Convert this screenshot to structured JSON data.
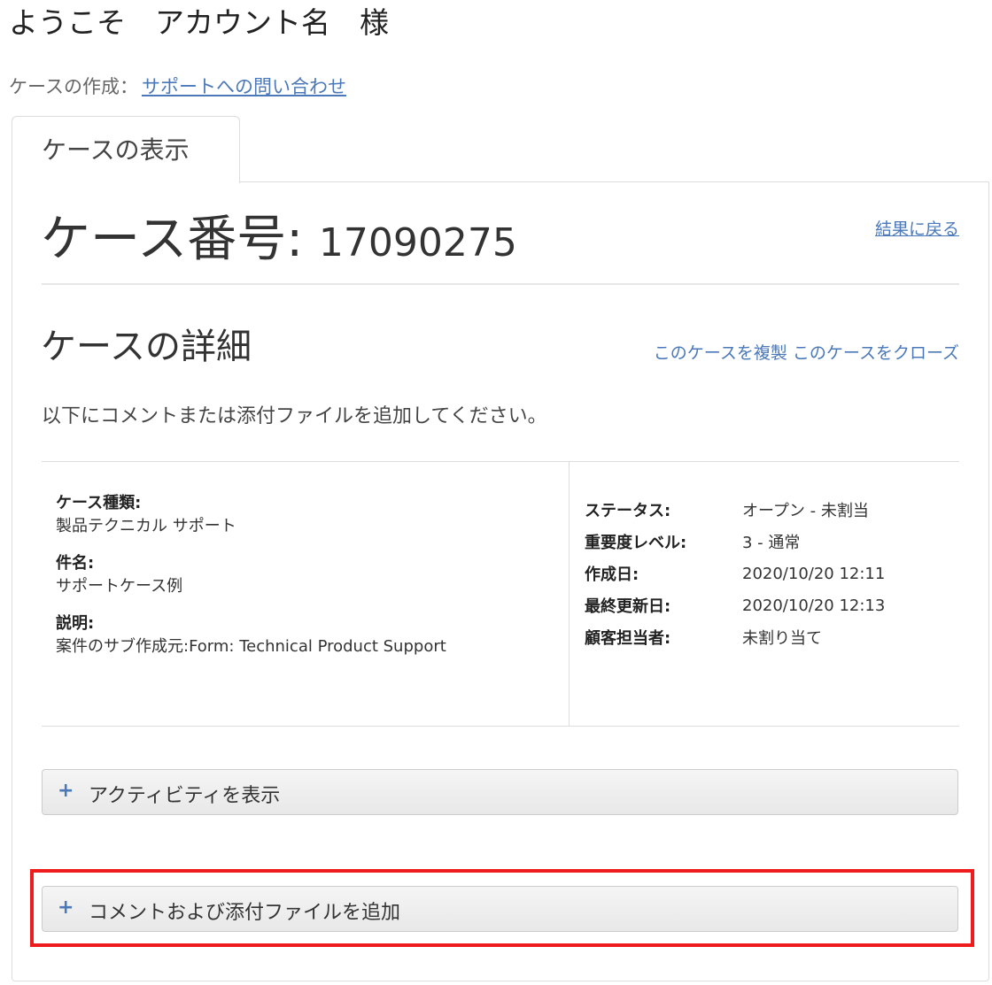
{
  "header": {
    "welcome": "ようこそ　アカウント名　様",
    "create_label": "ケースの作成：",
    "create_link": "サポートへの問い合わせ"
  },
  "tab": {
    "label": "ケースの表示"
  },
  "case": {
    "number_label": "ケース番号: ",
    "number": "17090275",
    "back_link": "結果に戻る",
    "details_title": "ケースの詳細",
    "clone_link": "このケースを複製",
    "close_link": "このケースをクローズ",
    "instructions": "以下にコメントまたは添付ファイルを追加してください。"
  },
  "left_fields": [
    {
      "label": "ケース種類:",
      "value": "製品テクニカル サポート"
    },
    {
      "label": "件名:",
      "value": "サポートケース例"
    },
    {
      "label": "説明:",
      "value": "案件のサブ作成元:Form: Technical Product Support"
    }
  ],
  "right_fields": [
    {
      "label": "ステータス:",
      "value": "オープン - 未割当"
    },
    {
      "label": "重要度レベル:",
      "value": "3 - 通常"
    },
    {
      "label": "作成日:",
      "value": "2020/10/20 12:11"
    },
    {
      "label": "最終更新日:",
      "value": "2020/10/20 12:13"
    },
    {
      "label": "顧客担当者:",
      "value": "未割り当て"
    }
  ],
  "accordions": {
    "activity": {
      "icon": "plus-icon",
      "label": "アクティビティを表示"
    },
    "comment": {
      "icon": "plus-icon",
      "label": "コメントおよび添付ファイルを追加"
    }
  },
  "colors": {
    "link": "#4a78b8",
    "highlight": "#ee1c1c"
  }
}
